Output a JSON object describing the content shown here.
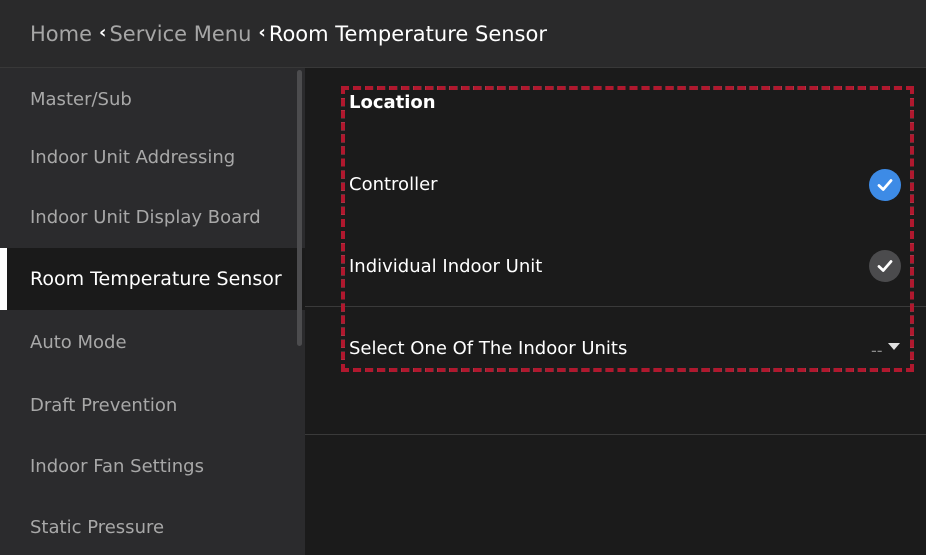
{
  "breadcrumb": {
    "home": "Home",
    "service_menu": "Service Menu",
    "current": "Room Temperature Sensor"
  },
  "sidebar": {
    "items": [
      {
        "label": "Master/Sub",
        "active": false
      },
      {
        "label": "Indoor Unit Addressing",
        "active": false
      },
      {
        "label": "Indoor Unit Display Board",
        "active": false
      },
      {
        "label": "Room Temperature Sensor",
        "active": true
      },
      {
        "label": "Auto Mode",
        "active": false
      },
      {
        "label": "Draft Prevention",
        "active": false
      },
      {
        "label": "Indoor Fan Settings",
        "active": false
      },
      {
        "label": "Static Pressure",
        "active": false
      }
    ]
  },
  "main": {
    "section_title": "Location",
    "options": [
      {
        "label": "Controller",
        "selected": true
      },
      {
        "label": "Individual Indoor Unit",
        "selected": false
      }
    ],
    "dropdown": {
      "label": "Select One Of The Indoor Units",
      "value": "--"
    }
  },
  "colors": {
    "accent_selected": "#3d8be6",
    "check_unselected": "#4b4b4d",
    "highlight_border": "#c0142a"
  },
  "icons": {
    "breadcrumb_separator": "chevron-left-icon",
    "check": "check-icon",
    "dropdown": "caret-down-icon"
  }
}
